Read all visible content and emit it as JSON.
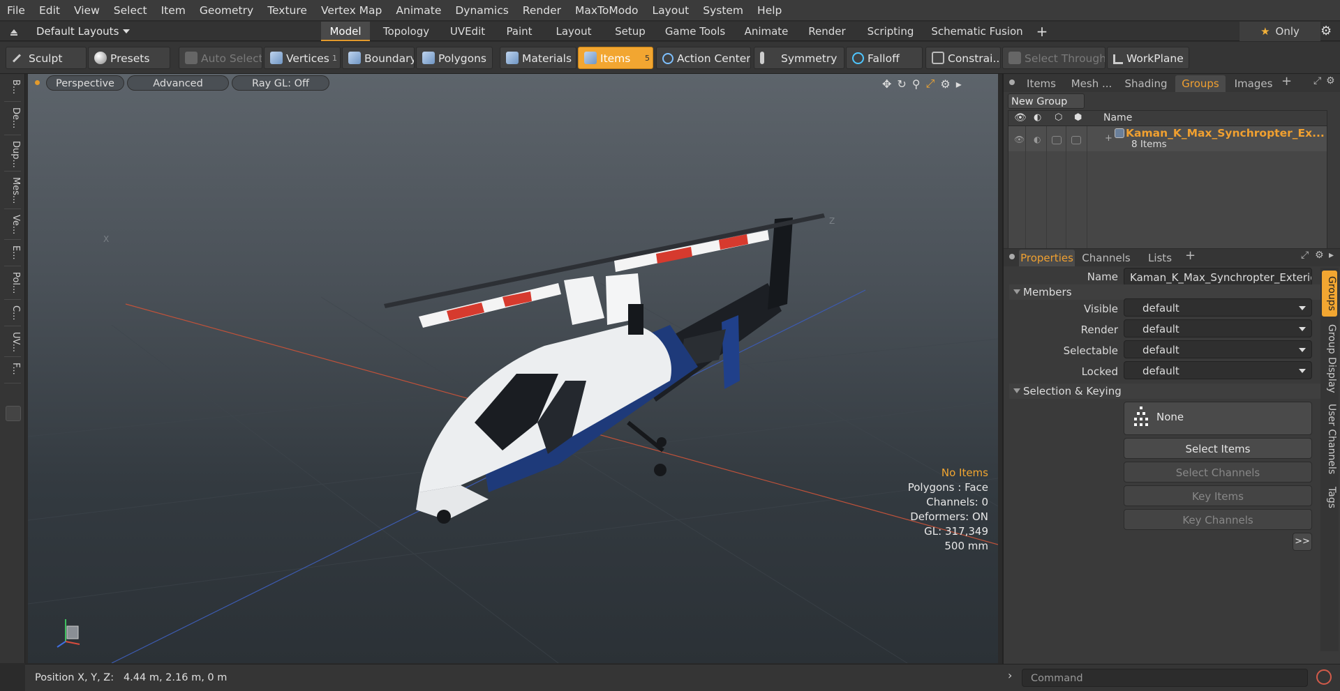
{
  "menu": [
    "File",
    "Edit",
    "View",
    "Select",
    "Item",
    "Geometry",
    "Texture",
    "Vertex Map",
    "Animate",
    "Dynamics",
    "Render",
    "MaxToModo",
    "Layout",
    "System",
    "Help"
  ],
  "layouts": {
    "preset": "Default Layouts",
    "tabs": [
      "Model",
      "Topology",
      "UVEdit",
      "Paint",
      "Layout",
      "Setup",
      "Game Tools",
      "Animate",
      "Render",
      "Scripting",
      "Schematic Fusion"
    ],
    "add": "+",
    "only": "Only"
  },
  "toolbar": {
    "sculpt": "Sculpt",
    "presets": "Presets",
    "auto_select": "Auto Select",
    "vertices": "Vertices",
    "vertices_count": "1",
    "boundary": "Boundary",
    "polygons": "Polygons",
    "materials": "Materials",
    "items": "Items",
    "items_count": "5",
    "action_center": "Action Center",
    "symmetry": "Symmetry",
    "falloff": "Falloff",
    "constraints": "Constrai...",
    "select_through": "Select Through",
    "workplane": "WorkPlane"
  },
  "left_tabs": [
    "B...",
    "De...",
    "Dup...",
    "Mes...",
    "Ve...",
    "E...",
    "Pol...",
    "C...",
    "UV...",
    "F..."
  ],
  "viewport": {
    "perspective": "Perspective",
    "advanced": "Advanced",
    "raygl": "Ray GL: Off",
    "axis_x": "X",
    "axis_z": "Z",
    "hud": {
      "items": "No Items",
      "polygons": "Polygons : Face",
      "channels": "Channels: 0",
      "deformers": "Deformers: ON",
      "gl": "GL: 317,349",
      "scale": "500 mm"
    }
  },
  "status": {
    "position": "Position X, Y, Z:   4.44 m, 2.16 m, 0 m",
    "command_placeholder": "Command"
  },
  "groups_panel": {
    "tabs": [
      "Items",
      "Mesh ...",
      "Shading",
      "Groups",
      "Images"
    ],
    "active_tab": "Groups",
    "new_group": "New Group",
    "col_name": "Name",
    "group_name": "Kaman_K_Max_Synchropter_Ex...",
    "group_count": "8 Items"
  },
  "properties": {
    "tabs": [
      "Properties",
      "Channels",
      "Lists"
    ],
    "name_label": "Name",
    "name_value": "Kaman_K_Max_Synchropter_Exterior",
    "members": "Members",
    "visible_label": "Visible",
    "visible_value": "default",
    "render_label": "Render",
    "render_value": "default",
    "selectable_label": "Selectable",
    "selectable_value": "default",
    "locked_label": "Locked",
    "locked_value": "default",
    "sel_keying": "Selection & Keying",
    "none": "None",
    "select_items": "Select Items",
    "select_channels": "Select Channels",
    "key_items": "Key Items",
    "key_channels": "Key Channels",
    "more": ">>",
    "side_tabs": [
      "Groups",
      "Group Display",
      "User Channels",
      "Tags"
    ]
  },
  "colors": {
    "accent": "#f2a631",
    "group_name": "#f0a030"
  }
}
